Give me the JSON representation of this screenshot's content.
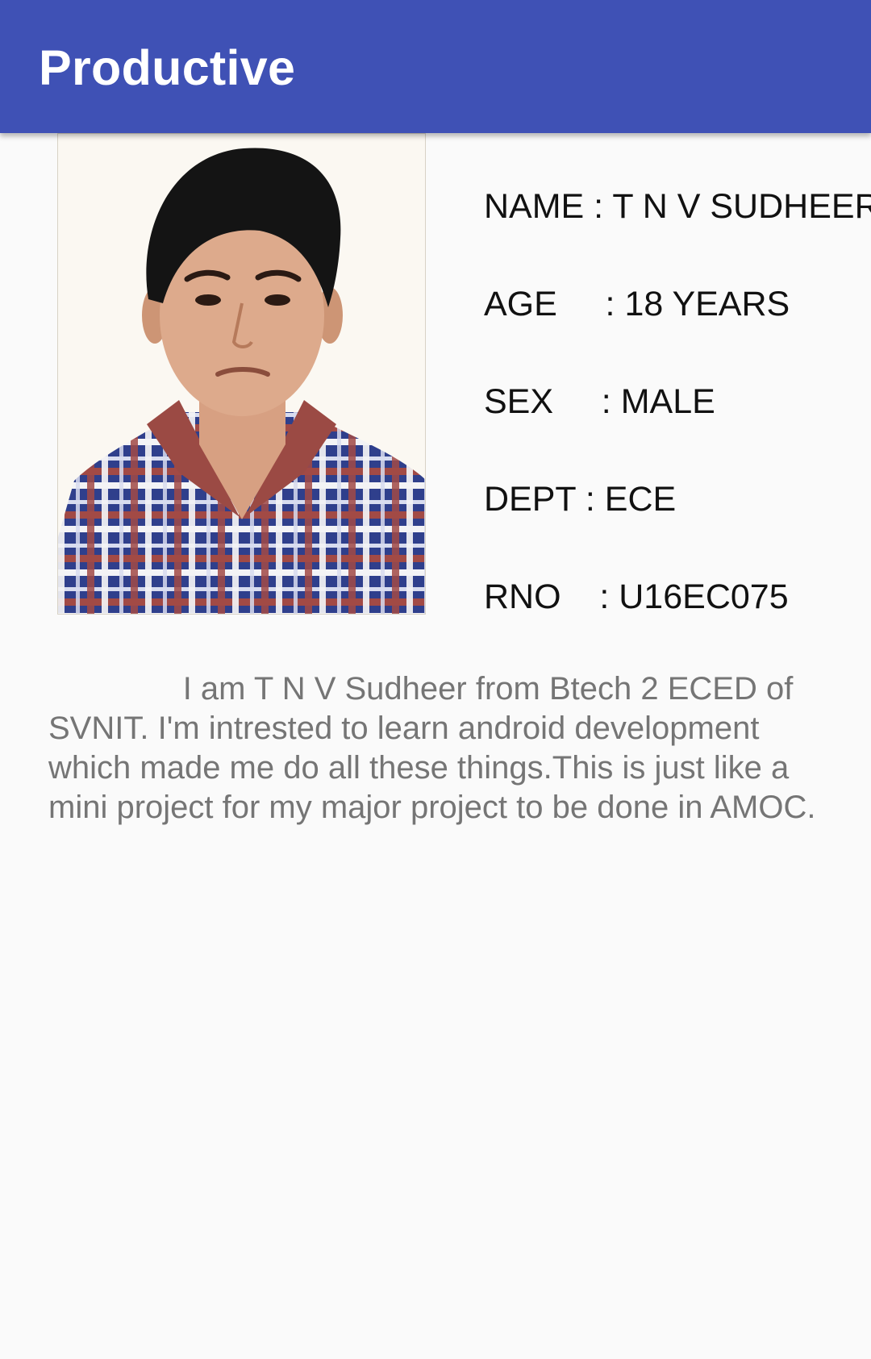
{
  "app_bar": {
    "title": "Productive",
    "color": "#3f51b5"
  },
  "profile": {
    "photo_icon": "person-photo",
    "fields": [
      {
        "label": "NAME :",
        "value": "T N V SUDHEER"
      },
      {
        "label": "AGE     :",
        "value": "18 YEARS"
      },
      {
        "label": "SEX     :",
        "value": "MALE"
      },
      {
        "label": "DEPT :",
        "value": "ECE"
      },
      {
        "label": "RNO    :",
        "value": "U16EC075"
      }
    ]
  },
  "about": {
    "text": "               I am T N V Sudheer from Btech 2 ECED of SVNIT. I'm intrested to learn android development which made me do all these things.This is just like a mini project for my major project to be done in AMOC."
  }
}
